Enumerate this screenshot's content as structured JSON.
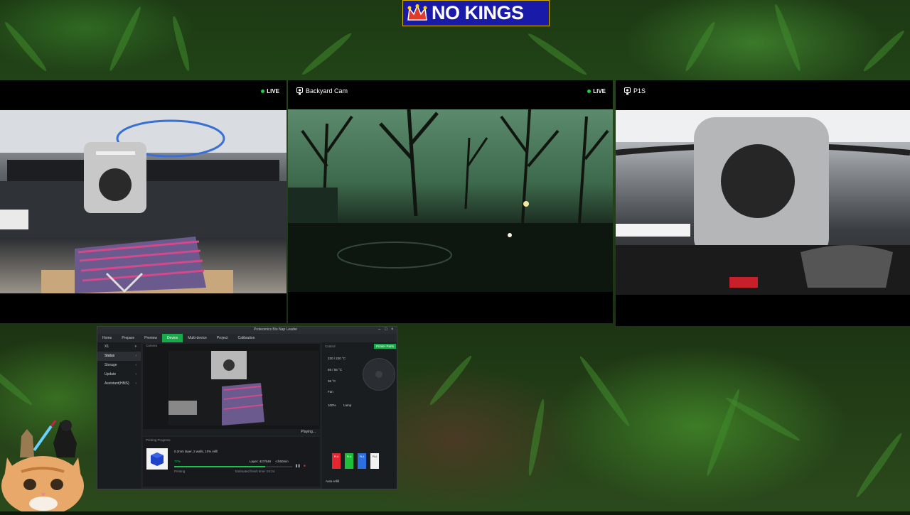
{
  "overlay": {
    "logo_text": "NO KINGS",
    "brand_colors": {
      "logo_bg": "#1a1aa8",
      "logo_border": "#d4b400",
      "crown": "#e03a2a"
    }
  },
  "cameras": [
    {
      "name": "",
      "live_label": "LIVE",
      "live": true
    },
    {
      "name": "Backyard Cam",
      "live_label": "LIVE",
      "live": true
    },
    {
      "name": "P1S",
      "live_label": "",
      "live": false
    }
  ],
  "studio": {
    "title": "Proteomics Bio Nap Leader",
    "tabs": [
      "Home",
      "Prepare",
      "Preview",
      "Device",
      "Multi-device",
      "Project",
      "Calibration"
    ],
    "active_tab": "Device",
    "printer_name": "X1",
    "sidebar": [
      "Status",
      "Storage",
      "Update",
      "Assistant(HMS)"
    ],
    "camera_header": "Camera",
    "playing_label": "Playing...",
    "printing_progress_label": "Printing Progress",
    "job_name": "0.2mm layer, 2 walls, 10% infill",
    "progress_percent": 77,
    "progress_label": "77%",
    "status_label": "Printing",
    "layer_label": "Layer: 427/548",
    "remaining_label": "-1h50min",
    "finish_label": "Estimated finish time: 04:24",
    "control_header": "Control",
    "printer_parts_label": "Printer Parts",
    "temps": [
      "220 / 220 °C",
      "55 / 55 °C",
      "36 °C"
    ],
    "fan_label": "Fan",
    "fan_values": [
      "100%",
      "Lamp"
    ],
    "ams_label": "Auto-refill",
    "filaments": [
      {
        "label": "PLA",
        "color": "#e3262f"
      },
      {
        "label": "PLA",
        "color": "#1fbe3a"
      },
      {
        "label": "PLA",
        "color": "#2b6fe0"
      },
      {
        "label": "PLA",
        "color": "#f2f2f2"
      }
    ]
  }
}
